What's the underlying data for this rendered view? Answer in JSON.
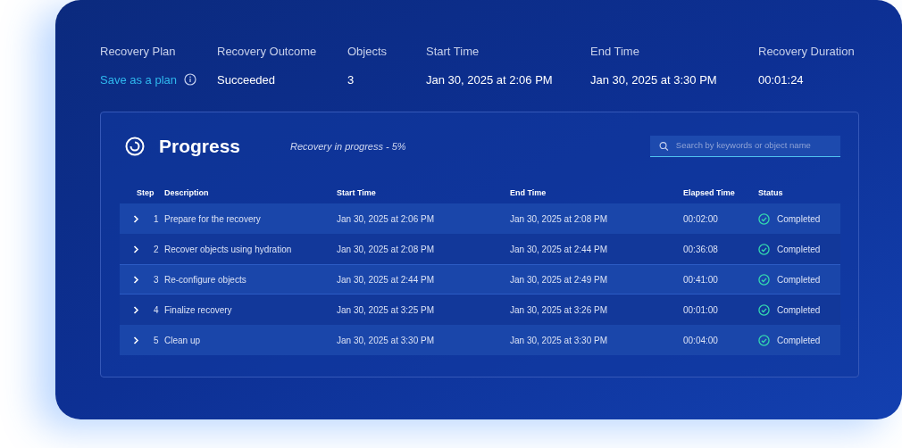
{
  "summary": [
    {
      "label": "Recovery Plan",
      "value": "Save as a plan",
      "kind": "link"
    },
    {
      "label": "Recovery Outcome",
      "value": "Succeeded",
      "kind": "text"
    },
    {
      "label": "Objects",
      "value": "3",
      "kind": "text"
    },
    {
      "label": "Start Time",
      "value": "Jan 30, 2025 at 2:06 PM",
      "kind": "text"
    },
    {
      "label": "End Time",
      "value": "Jan 30, 2025 at 3:30 PM",
      "kind": "text"
    },
    {
      "label": "Recovery Duration",
      "value": "00:01:24",
      "kind": "text"
    }
  ],
  "progress": {
    "title": "Progress",
    "subtitle": "Recovery in progress - 5%",
    "search": {
      "placeholder": "Search by keywords or object name"
    },
    "columns": [
      "Step",
      "Description",
      "Start Time",
      "End Time",
      "Elapsed Time",
      "Status"
    ],
    "rows": [
      {
        "step": "1",
        "description": "Prepare for the recovery",
        "start": "Jan 30, 2025 at 2:06 PM",
        "end": "Jan 30, 2025 at 2:08 PM",
        "elapsed": "00:02:00",
        "status": "Completed",
        "kind": "completed"
      },
      {
        "step": "2",
        "description": "Recover objects using hydration",
        "start": "Jan 30, 2025 at 2:08 PM",
        "end": "Jan 30, 2025 at 2:44 PM",
        "elapsed": "00:36:08",
        "status": "Completed",
        "kind": "completed"
      },
      {
        "step": "3",
        "description": "Re-configure objects",
        "start": "Jan 30, 2025 at 2:44 PM",
        "end": "Jan 30, 2025 at 2:49 PM",
        "elapsed": "00:41:00",
        "status": "Completed",
        "kind": "completed"
      },
      {
        "step": "4",
        "description": "Finalize recovery",
        "start": "Jan 30, 2025 at 3:25 PM",
        "end": "Jan 30, 2025 at 3:26 PM",
        "elapsed": "00:01:00",
        "status": "Completed",
        "kind": "completed"
      },
      {
        "step": "5",
        "description": "Clean up",
        "start": "Jan 30, 2025 at 3:30 PM",
        "end": "Jan 30, 2025 at 3:30 PM",
        "elapsed": "00:04:00",
        "status": "Completed",
        "kind": "completed"
      }
    ]
  }
}
